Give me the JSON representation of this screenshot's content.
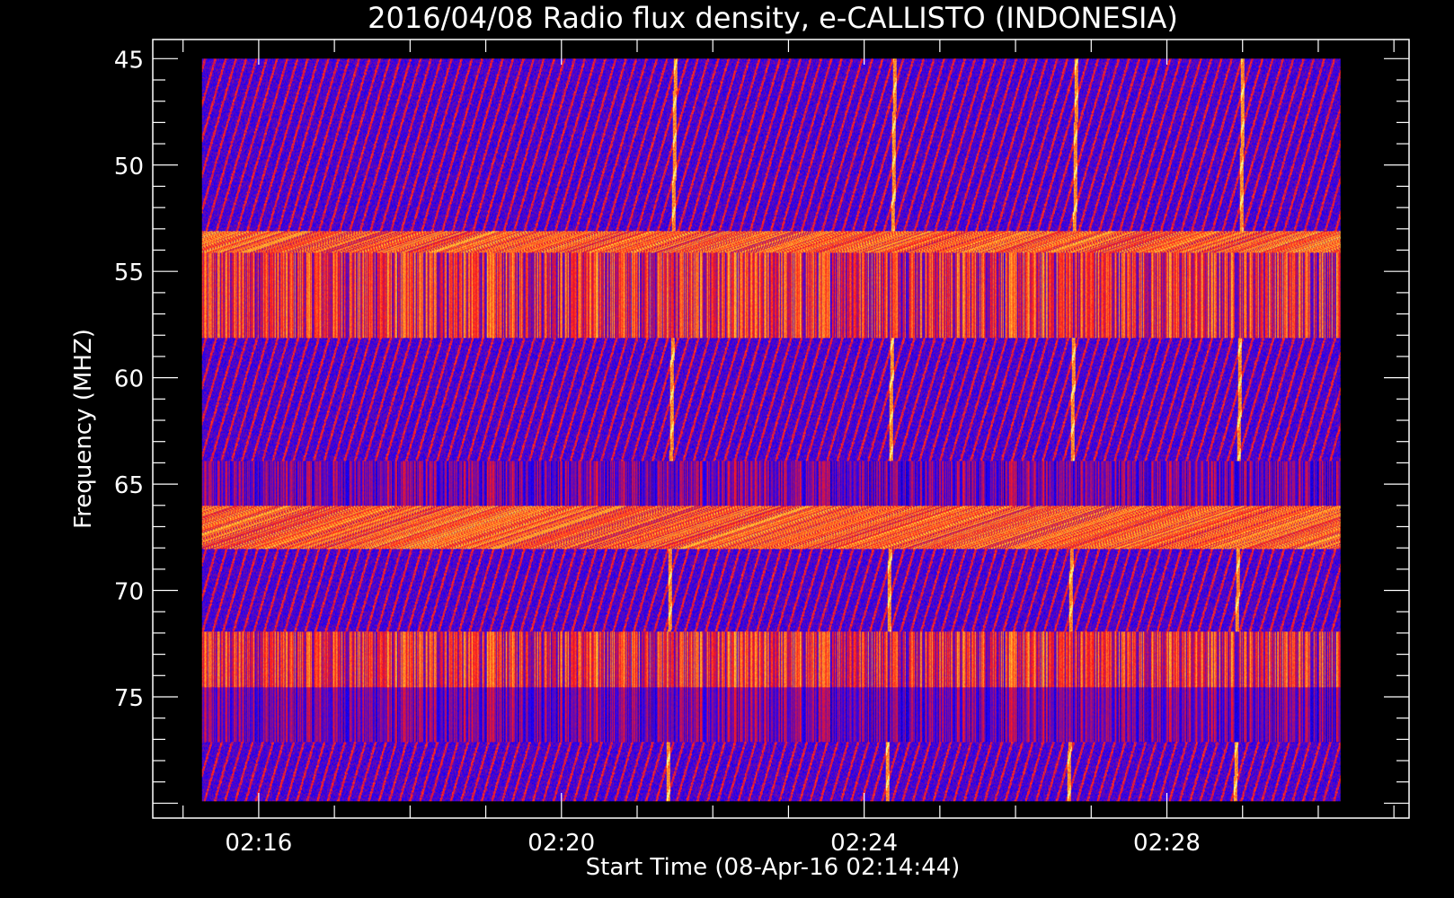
{
  "chart_data": {
    "type": "heatmap",
    "title": "2016/04/08  Radio flux density, e-CALLISTO (INDONESIA)",
    "xlabel": "Start Time (08-Apr-16 02:14:44)",
    "ylabel": "Frequency (MHZ)",
    "x_tick_labels": [
      "02:16",
      "02:20",
      "02:24",
      "02:28"
    ],
    "x_tick_minutes": [
      16,
      20,
      24,
      28
    ],
    "x_range_minutes": [
      14.6,
      31.2
    ],
    "data_x_range_minutes": [
      15.25,
      30.3
    ],
    "y_tick_values": [
      45,
      50,
      55,
      60,
      65,
      70,
      75
    ],
    "y_range": [
      44.1,
      80.7
    ],
    "data_y_range": [
      45,
      79.9
    ],
    "colormap": [
      "#000000",
      "#1a00ff",
      "#ff1a1a",
      "#ffdd33",
      "#ffffff"
    ],
    "background_level": "blue",
    "interference_bands_mhz": [
      {
        "from": 53.1,
        "to": 54.1,
        "kind": "red-striped"
      },
      {
        "from": 54.1,
        "to": 58.1,
        "kind": "vertical-striped"
      },
      {
        "from": 63.9,
        "to": 66.0,
        "kind": "blue-vertical-striped"
      },
      {
        "from": 66.0,
        "to": 68.0,
        "kind": "red-striped"
      },
      {
        "from": 71.9,
        "to": 74.5,
        "kind": "vertical-striped"
      },
      {
        "from": 74.5,
        "to": 77.1,
        "kind": "blue-vertical-striped"
      }
    ],
    "bright_drifting_features_minutes": [
      21.5,
      24.4,
      26.8,
      29.0
    ]
  }
}
